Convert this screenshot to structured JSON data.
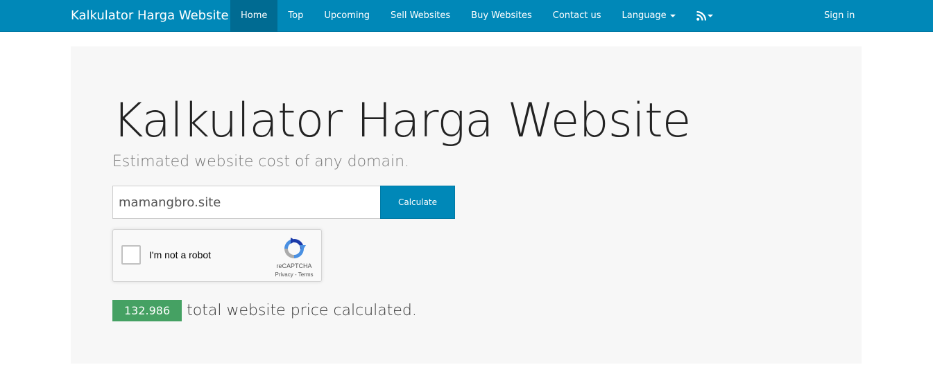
{
  "navbar": {
    "brand": "Kalkulator Harga Website",
    "items": [
      {
        "label": "Home",
        "active": true
      },
      {
        "label": "Top"
      },
      {
        "label": "Upcoming"
      },
      {
        "label": "Sell Websites"
      },
      {
        "label": "Buy Websites"
      },
      {
        "label": "Contact us"
      },
      {
        "label": "Language"
      }
    ],
    "rss_icon": "rss-icon",
    "signin": "Sign in",
    "color": "#0088b8",
    "active_color": "#006b92"
  },
  "main": {
    "title": "Kalkulator Harga Website",
    "subtitle": "Estimated website cost of any domain.",
    "domain_input": {
      "value": "mamangbro.site"
    },
    "calculate_button": "Calculate"
  },
  "captcha": {
    "label": "I'm not a robot",
    "brand": "reCAPTCHA",
    "privacy": "Privacy",
    "separator": " - ",
    "terms": "Terms",
    "checked": false
  },
  "result": {
    "count": "132.986",
    "text": "total website price calculated.",
    "badge_color": "#45a163"
  }
}
